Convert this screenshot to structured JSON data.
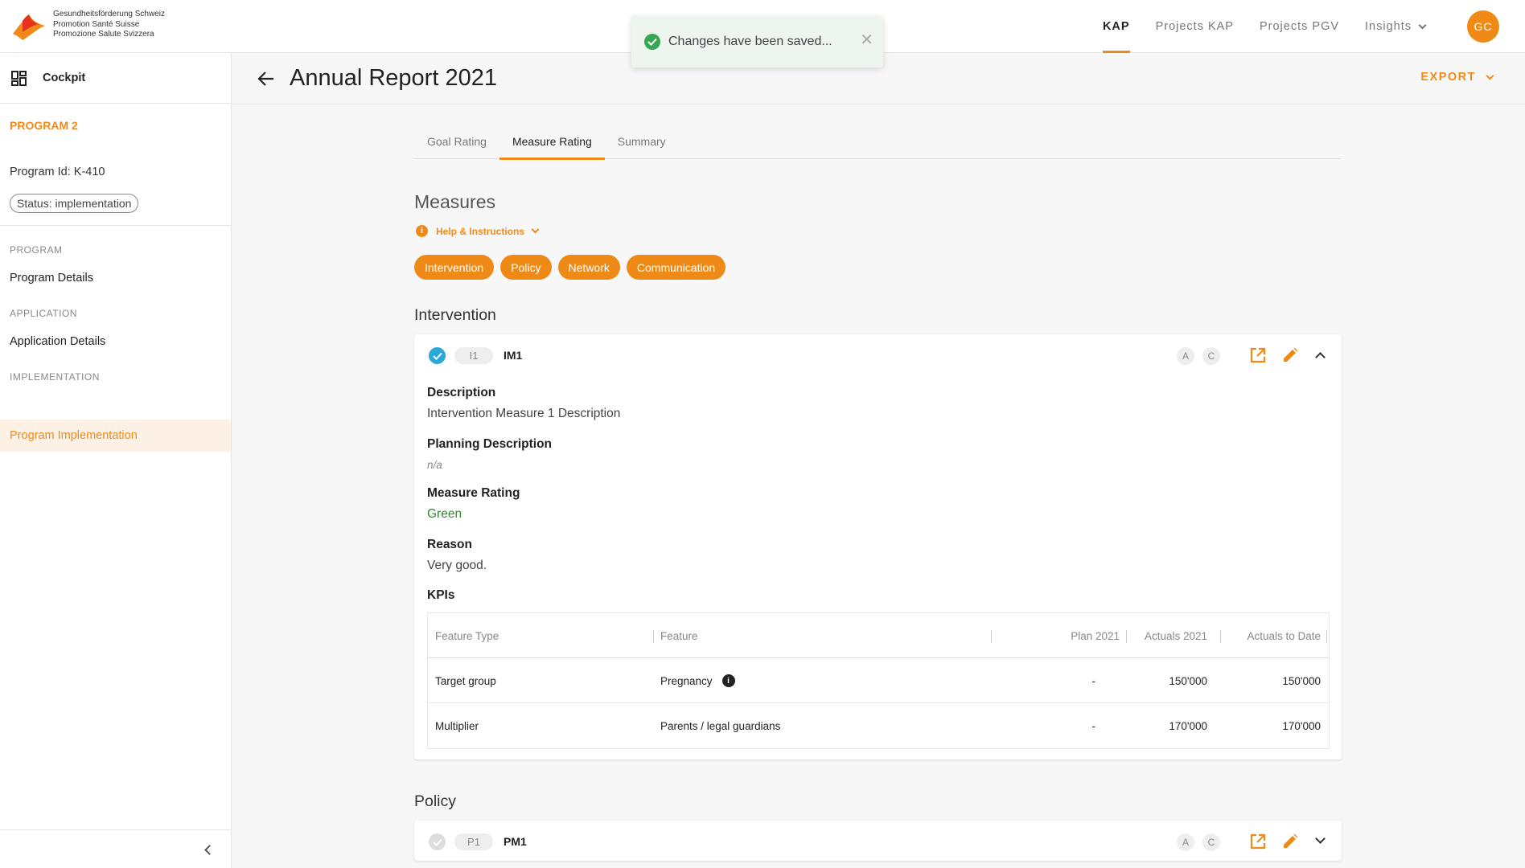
{
  "logo": {
    "line1": "Gesundheitsförderung Schweiz",
    "line2": "Promotion Santé Suisse",
    "line3": "Promozione Salute Svizzera"
  },
  "nav": {
    "items": [
      {
        "label": "KAP"
      },
      {
        "label": "Projects KAP"
      },
      {
        "label": "Projects PGV"
      },
      {
        "label": "Insights"
      }
    ],
    "avatar": "GC"
  },
  "toast": {
    "message": "Changes have been saved...",
    "close": "✕"
  },
  "sidebar": {
    "cockpit": "Cockpit",
    "program_name": "PROGRAM 2",
    "program_id": "Program Id: K-410",
    "status": "Status: implementation",
    "sections": [
      {
        "label": "PROGRAM",
        "item": "Program Details"
      },
      {
        "label": "APPLICATION",
        "item": "Application Details"
      },
      {
        "label": "IMPLEMENTATION",
        "item": "Program Implementation"
      }
    ]
  },
  "header": {
    "title": "Annual Report 2021",
    "export": "EXPORT"
  },
  "tabs": [
    {
      "label": "Goal Rating"
    },
    {
      "label": "Measure Rating"
    },
    {
      "label": "Summary"
    }
  ],
  "measures": {
    "title": "Measures",
    "help": "Help & Instructions",
    "chips": [
      "Intervention",
      "Policy",
      "Network",
      "Communication"
    ]
  },
  "intervention": {
    "group_title": "Intervention",
    "card": {
      "pill": "I1",
      "code": "IM1",
      "badge_a": "A",
      "badge_c": "C",
      "description_label": "Description",
      "description": "Intervention Measure 1 Description",
      "planning_label": "Planning Description",
      "planning": "n/a",
      "rating_label": "Measure Rating",
      "rating": "Green",
      "reason_label": "Reason",
      "reason": "Very good.",
      "kpis_label": "KPIs",
      "kpi_headers": [
        "Feature Type",
        "Feature",
        "Plan 2021",
        "Actuals 2021",
        "Actuals to Date"
      ],
      "kpi_rows": [
        [
          "Target group",
          "Pregnancy",
          "-",
          "150'000",
          "150'000"
        ],
        [
          "Multiplier",
          "Parents / legal guardians",
          "-",
          "170'000",
          "170'000"
        ]
      ]
    }
  },
  "policy": {
    "group_title": "Policy",
    "card": {
      "pill": "P1",
      "code": "PM1",
      "badge_a": "A",
      "badge_c": "C"
    }
  },
  "colors": {
    "accent": "#f08a17",
    "success": "#3aa655",
    "check_blue": "#2aa8d8",
    "rating_green": "#2e8b2e"
  }
}
